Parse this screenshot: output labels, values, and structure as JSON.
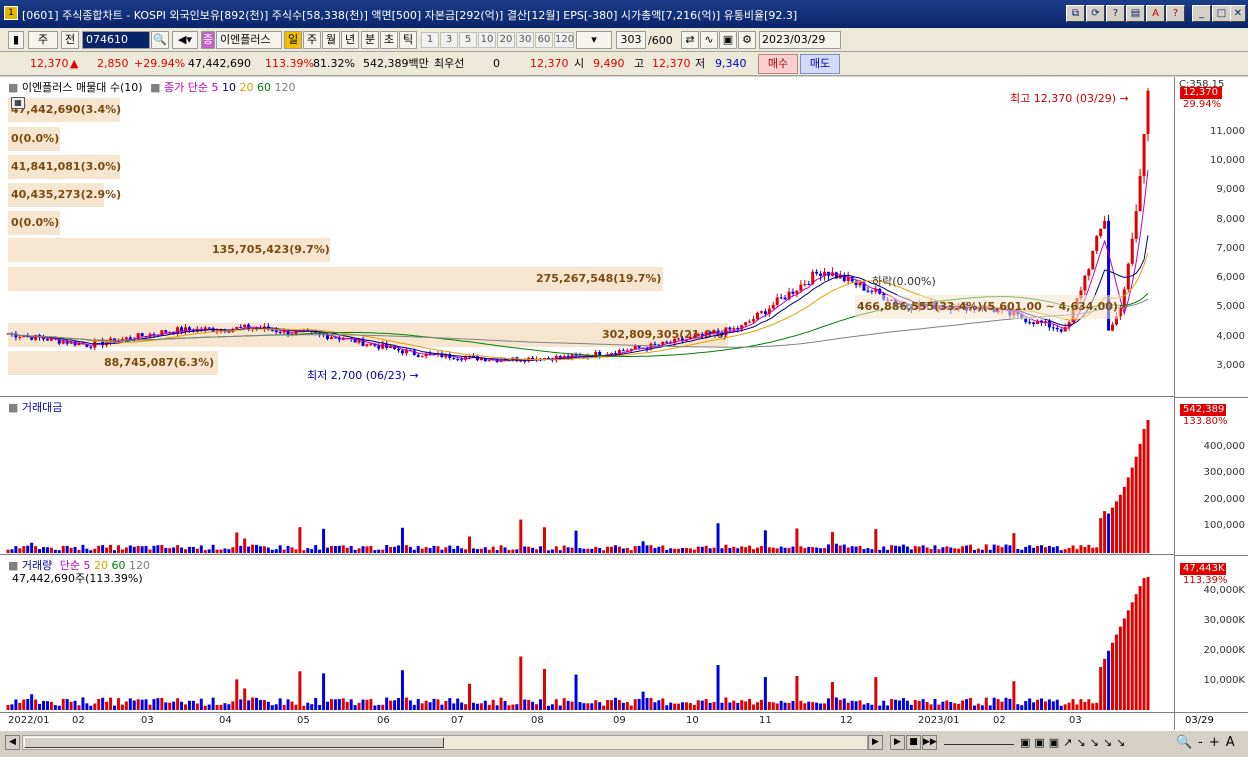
{
  "window": {
    "title": "[0601] 주식종합차트 - KOSPI 외국인보유[892(천)] 주식수[58,338(천)] 액면[500] 자본금[292(억)] 결산[12월] EPS[-380] 시가총액[7,216(억)] 유통비율[92.3]",
    "icon": "1",
    "buttons": [
      "restore-icon",
      "refresh-icon",
      "help-question-icon",
      "save-icon",
      "font-icon",
      "question-icon",
      "minimize-icon",
      "maximize-icon",
      "close-icon"
    ]
  },
  "toolbar": {
    "mode1": "주",
    "mode2": "전",
    "code": "074610",
    "name_label": "이엔플러스",
    "period_tabs": [
      "일",
      "주",
      "월",
      "년",
      "분",
      "초",
      "틱"
    ],
    "period_selected": "일",
    "intervals": [
      "1",
      "3",
      "5",
      "10",
      "20",
      "30",
      "60",
      "120"
    ],
    "count": "303",
    "count_total": "/600",
    "date": "2023/03/29"
  },
  "quote": {
    "price": "12,370",
    "change": "2,850",
    "change_pct": "+29.94%",
    "volume": "47,442,690",
    "volume_pct": "113.39%",
    "ratio": "81.32%",
    "amount": "542,389백만",
    "pref_label": "최우선",
    "pref_value": "0",
    "ask": "12,370",
    "open_label": "시",
    "open": "9,490",
    "high_label": "고",
    "high": "12,370",
    "low_label": "저",
    "low": "9,340",
    "buy_label": "매수",
    "sell_label": "매도"
  },
  "price_panel": {
    "legend_title": "이엔플러스 매물대 수(10)",
    "ma_label": "종가 단순",
    "ma_periods": [
      "5",
      "10",
      "20",
      "60",
      "120"
    ],
    "ma_colors": [
      "#c000c0",
      "#000080",
      "#e0a000",
      "#008000",
      "#808080"
    ],
    "annotations": [
      "47,442,690(3.4%)",
      "0(0.0%)",
      "41,841,081(3.0%)",
      "40,435,273(2.9%)",
      "0(0.0%)",
      "135,705,423(9.7%)",
      "275,267,548(19.7%)",
      "302,809,305(21.6%)",
      "88,745,087(6.3%)",
      "466,886,555(33.4%)(5,601.00 ~ 4,634.00)"
    ],
    "high_marker": "최고 12,370 (03/29)",
    "low_marker": "최저 2,700 (06/23)",
    "drop_marker": "하락(0.00%)",
    "axis_label_top": "C:358.15",
    "current_price": "12,370",
    "current_pct": "29.94%",
    "yticks": [
      "11,000",
      "10,000",
      "9,000",
      "8,000",
      "7,000",
      "6,000",
      "5,000",
      "4,000",
      "3,000"
    ]
  },
  "amount_panel": {
    "legend_title": "거래대금",
    "current": "542,389",
    "current_pct": "133.80%",
    "yticks": [
      "400,000",
      "300,000",
      "200,000",
      "100,000"
    ]
  },
  "volume_panel": {
    "legend_title": "거래량",
    "ma_label": "단순",
    "ma_periods": [
      "5",
      "20",
      "60",
      "120"
    ],
    "current_text": "47,442,690주(113.39%)",
    "current": "47,443K",
    "current_pct": "113.39%",
    "yticks": [
      "40,000K",
      "30,000K",
      "20,000K",
      "10,000K"
    ]
  },
  "xaxis": {
    "labels": [
      "2022/01",
      "02",
      "03",
      "04",
      "05",
      "06",
      "07",
      "08",
      "09",
      "10",
      "11",
      "12",
      "2023/01",
      "02",
      "03"
    ],
    "right_label": "03/29"
  },
  "chart_data": {
    "type": "candlestick",
    "title": "이엔플러스",
    "price_range": [
      2500,
      12500
    ],
    "monthly_close": [
      {
        "month": "2022/01",
        "close": 4000
      },
      {
        "month": "2022/02",
        "close": 3600
      },
      {
        "month": "2022/03",
        "close": 4100
      },
      {
        "month": "2022/04",
        "close": 4200
      },
      {
        "month": "2022/05",
        "close": 3900
      },
      {
        "month": "2022/06",
        "close": 3300
      },
      {
        "month": "2022/07",
        "close": 3100
      },
      {
        "month": "2022/08",
        "close": 3200
      },
      {
        "month": "2022/09",
        "close": 3600
      },
      {
        "month": "2022/10",
        "close": 4200
      },
      {
        "month": "2022/11",
        "close": 6200
      },
      {
        "month": "2022/12",
        "close": 5000
      },
      {
        "month": "2023/01",
        "close": 4900
      },
      {
        "month": "2023/02",
        "close": 4100
      },
      {
        "month": "2023/03",
        "close": 12370
      }
    ],
    "high": 12370,
    "low": 2700
  }
}
